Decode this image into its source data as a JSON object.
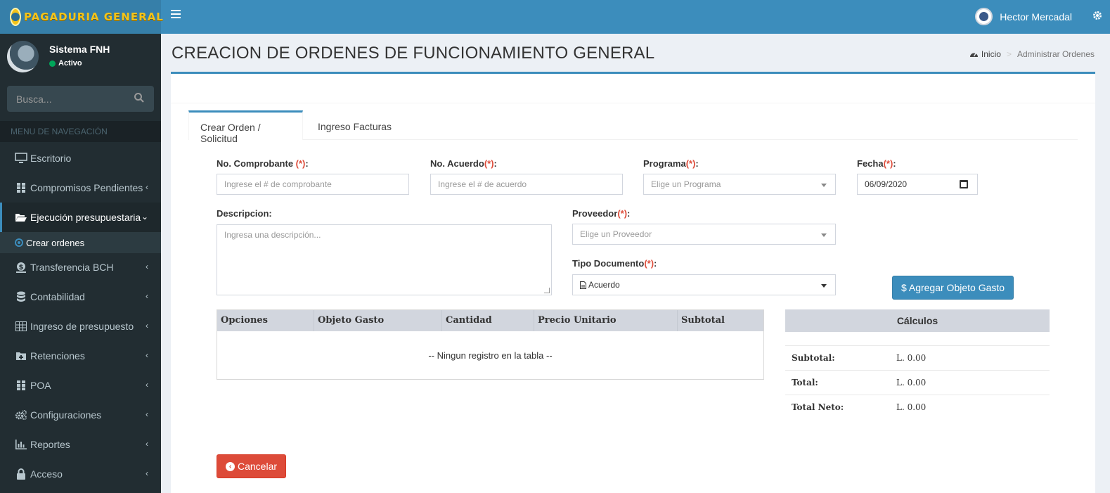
{
  "brand": {
    "name": "PAGADURIA GENERAL"
  },
  "header": {
    "user_name": "Hector Mercadal"
  },
  "sidebar": {
    "user": {
      "name": "Sistema FNH",
      "status": "Activo"
    },
    "search_placeholder": "Busca...",
    "nav_header": "MENU DE NAVEGACIÓN",
    "items": [
      {
        "label": "Escritorio",
        "icon": "desktop-icon"
      },
      {
        "label": "Compromisos Pendientes",
        "icon": "th-icon"
      },
      {
        "label": "Ejecución presupuestaria",
        "icon": "folder-open-icon",
        "active": true
      },
      {
        "label": "Transferencia BCH",
        "icon": "dollar-icon"
      },
      {
        "label": "Contabilidad",
        "icon": "database-icon"
      },
      {
        "label": "Ingreso de presupuesto",
        "icon": "table-icon"
      },
      {
        "label": "Retenciones",
        "icon": "folder-plus-icon"
      },
      {
        "label": "POA",
        "icon": "th-icon"
      },
      {
        "label": "Configuraciones",
        "icon": "cogs-icon"
      },
      {
        "label": "Reportes",
        "icon": "bar-chart-icon"
      },
      {
        "label": "Acceso",
        "icon": "lock-icon"
      }
    ],
    "sub_item": "Crear ordenes"
  },
  "page": {
    "title": "CREACION DE ORDENES DE FUNCIONAMIENTO GENERAL",
    "breadcrumb": {
      "home": "Inicio",
      "current": "Administrar Ordenes"
    }
  },
  "tabs": [
    {
      "label": "Crear Orden / Solicitud",
      "active": true
    },
    {
      "label": "Ingreso Facturas",
      "active": false
    }
  ],
  "form": {
    "comprobante": {
      "label": "No. Comprobante ",
      "req": "(*)",
      "colon": ":",
      "placeholder": "Ingrese el # de comprobante"
    },
    "acuerdo": {
      "label": "No. Acuerdo",
      "req": "(*)",
      "colon": ":",
      "placeholder": "Ingrese el # de acuerdo"
    },
    "programa": {
      "label": "Programa",
      "req": "(*)",
      "colon": ":",
      "placeholder": "Elige un Programa"
    },
    "fecha": {
      "label": "Fecha",
      "req": "(*)",
      "colon": ":",
      "value": "06/09/2020"
    },
    "descripcion": {
      "label": "Descripcion:",
      "placeholder": "Ingresa una descripción..."
    },
    "proveedor": {
      "label": "Proveedor",
      "req": "(*)",
      "colon": ":",
      "placeholder": "Elige un Proveedor"
    },
    "tipo_documento": {
      "label": "Tipo Documento",
      "req": "(*)",
      "colon": ":",
      "value": "Acuerdo"
    }
  },
  "buttons": {
    "agregar": "$ Agregar Objeto Gasto",
    "cancelar": "Cancelar"
  },
  "table": {
    "columns": [
      "Opciones",
      "Objeto Gasto",
      "Cantidad",
      "Precio Unitario",
      "Subtotal"
    ],
    "empty": "-- Ningun registro en la tabla --"
  },
  "calculos": {
    "title": "Cálculos",
    "rows": [
      {
        "label": "Subtotal:",
        "value": "L. 0.00"
      },
      {
        "label": "Total:",
        "value": "L. 0.00"
      },
      {
        "label": "Total Neto:",
        "value": "L. 0.00"
      }
    ]
  }
}
